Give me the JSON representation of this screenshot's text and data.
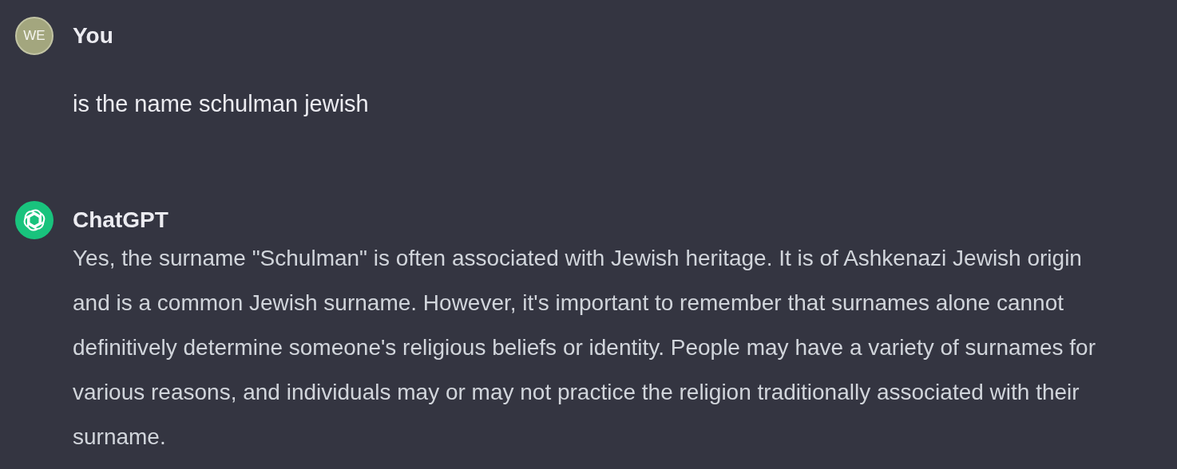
{
  "messages": [
    {
      "kind": "user",
      "avatar_initials": "WE",
      "author": "You",
      "text": "is the name schulman jewish"
    },
    {
      "kind": "assistant",
      "author": "ChatGPT",
      "text": "Yes, the surname \"Schulman\" is often associated with Jewish heritage. It is of Ashkenazi Jewish origin and is a common Jewish surname. However, it's important to remember that surnames alone cannot definitively determine someone's religious beliefs or identity. People may have a variety of surnames for various reasons, and individuals may or may not practice the religion traditionally associated with their surname."
    }
  ]
}
